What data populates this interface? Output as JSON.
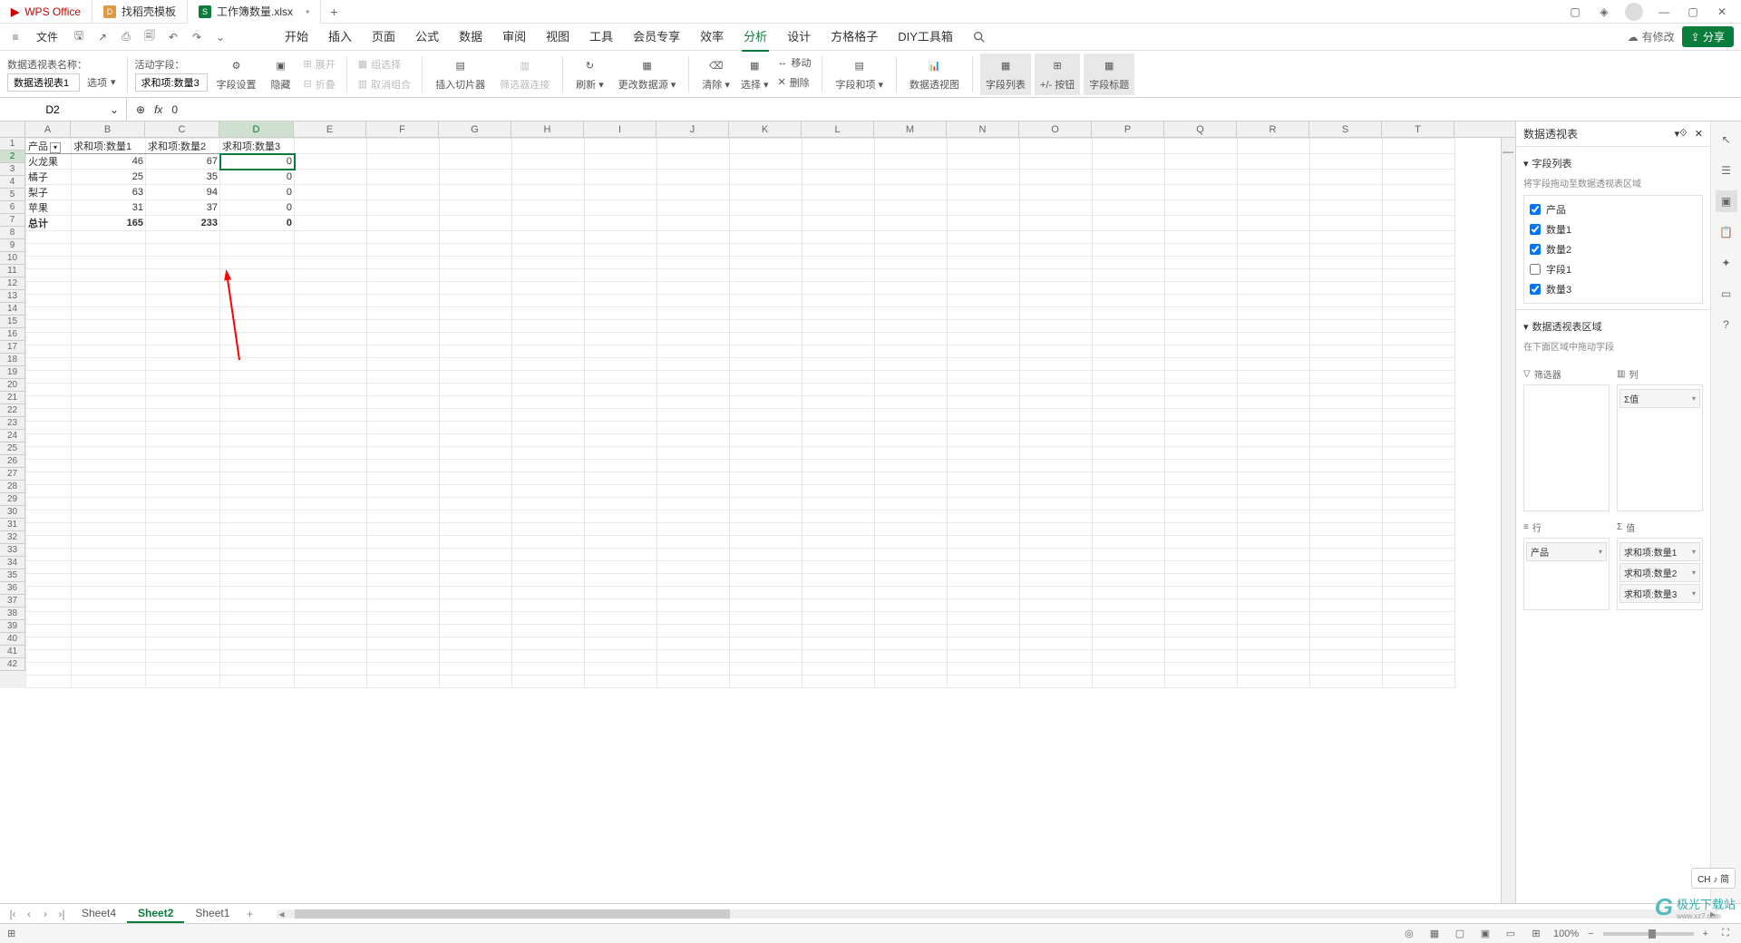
{
  "titlebar": {
    "app": "WPS Office",
    "tab_template": "找稻壳模板",
    "tab_doc": "工作簿数量.xlsx"
  },
  "menubar": {
    "file": "文件",
    "tabs": [
      "开始",
      "插入",
      "页面",
      "公式",
      "数据",
      "审阅",
      "视图",
      "工具",
      "会员专享",
      "效率",
      "分析",
      "设计",
      "方格格子",
      "DIY工具箱"
    ],
    "active_idx": 10,
    "modify": "有修改",
    "share": "分享"
  },
  "ribbon": {
    "name_label": "数据透视表名称：",
    "name_value": "数据透视表1",
    "options": "选项",
    "active_field_label": "活动字段：",
    "active_field_value": "求和项:数量3",
    "field_settings": "字段设置",
    "hide": "隐藏",
    "expand": "展开",
    "collapse": "折叠",
    "group_sel": "组选择",
    "ungroup": "取消组合",
    "insert_slicer": "插入切片器",
    "slicer_conn": "筛选器连接",
    "refresh": "刷新",
    "change_src": "更改数据源",
    "clear": "清除",
    "select": "选择",
    "move": "移动",
    "delete": "删除",
    "fields_items": "字段和项",
    "pivot_chart": "数据透视图",
    "field_list": "字段列表",
    "plus_minus": "+/- 按钮",
    "field_headers": "字段标题"
  },
  "formula": {
    "cell_ref": "D2",
    "value": "0",
    "fx": "fx"
  },
  "grid": {
    "cols": [
      "A",
      "B",
      "C",
      "D",
      "E",
      "F",
      "G",
      "H",
      "I",
      "J",
      "K",
      "L",
      "M",
      "N",
      "O",
      "P",
      "Q",
      "R",
      "S",
      "T"
    ],
    "selected_col_idx": 3,
    "rows": 42,
    "selected_row_idx": 1,
    "headers": [
      "产品",
      "求和项:数量1",
      "求和项:数量2",
      "求和项:数量3"
    ],
    "data": [
      [
        "火龙果",
        "46",
        "67",
        "0"
      ],
      [
        "橘子",
        "25",
        "35",
        "0"
      ],
      [
        "梨子",
        "63",
        "94",
        "0"
      ],
      [
        "苹果",
        "31",
        "37",
        "0"
      ]
    ],
    "total_label": "总计",
    "totals": [
      "165",
      "233",
      "0"
    ]
  },
  "panel": {
    "title": "数据透视表",
    "field_list_title": "字段列表",
    "field_hint": "将字段拖动至数据透视表区域",
    "fields": [
      {
        "label": "产品",
        "checked": true
      },
      {
        "label": "数量1",
        "checked": true
      },
      {
        "label": "数量2",
        "checked": true
      },
      {
        "label": "字段1",
        "checked": false
      },
      {
        "label": "数量3",
        "checked": true
      }
    ],
    "area_title": "数据透视表区域",
    "area_hint": "在下面区域中拖动字段",
    "filter_label": "筛选器",
    "col_label": "列",
    "row_label": "行",
    "val_label": "值",
    "col_items": [
      "Σ值"
    ],
    "row_items": [
      "产品"
    ],
    "val_items": [
      "求和项:数量1",
      "求和项:数量2",
      "求和项:数量3"
    ]
  },
  "sheets": {
    "tabs": [
      "Sheet4",
      "Sheet2",
      "Sheet1"
    ],
    "active_idx": 1
  },
  "status": {
    "zoom": "100%",
    "lang": "CH ♪ 简"
  },
  "watermark": {
    "text1": "极光下载站",
    "text2": "www.xz7.com"
  }
}
